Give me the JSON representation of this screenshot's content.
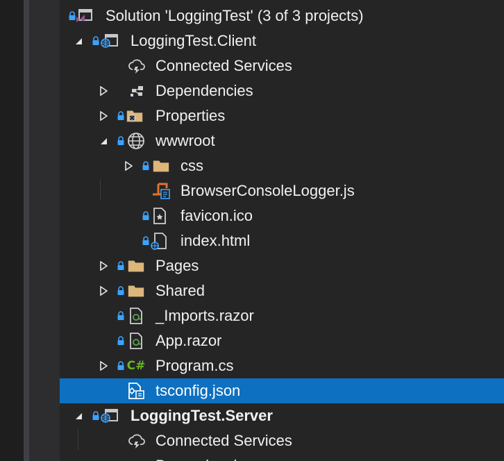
{
  "solution_explorer": {
    "rows": [
      {
        "label": "Solution 'LoggingTest' (3 of 3 projects)"
      },
      {
        "label": "LoggingTest.Client"
      },
      {
        "label": "Connected Services"
      },
      {
        "label": "Dependencies"
      },
      {
        "label": "Properties"
      },
      {
        "label": "wwwroot"
      },
      {
        "label": "css"
      },
      {
        "label": "BrowserConsoleLogger.js"
      },
      {
        "label": "favicon.ico"
      },
      {
        "label": "index.html"
      },
      {
        "label": "Pages"
      },
      {
        "label": "Shared"
      },
      {
        "label": "_Imports.razor"
      },
      {
        "label": "App.razor"
      },
      {
        "label": "Program.cs"
      },
      {
        "label": "tsconfig.json"
      },
      {
        "label": "LoggingTest.Server"
      },
      {
        "label": "Connected Services"
      },
      {
        "label": "Dependencies"
      }
    ],
    "csharp_glyph": "C#"
  },
  "colors": {
    "background": "#252526",
    "selection": "#0e70c0",
    "folder": "#dcb67a",
    "lock": "#3ba3ff",
    "csharp": "#68b723",
    "razor": "#57a64a",
    "js": "#e8702a",
    "vs_purple": "#9b4f96"
  }
}
